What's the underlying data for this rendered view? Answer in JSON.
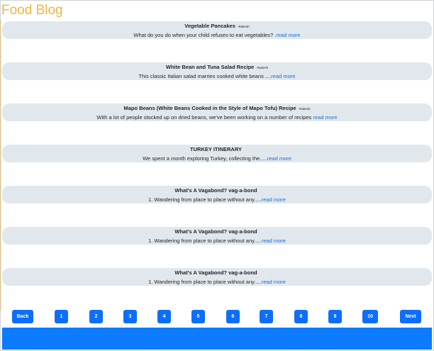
{
  "blog": {
    "title": "Food Blog"
  },
  "posts": [
    {
      "title": "Vegetable Pancakes",
      "author": "-Rakesh",
      "excerpt": "What do you do when your child refuses to eat vegetables? .",
      "read_more": "read more"
    },
    {
      "title": "White Bean and Tuna Salad Recipe",
      "author": "-Rakesh",
      "excerpt": "This classic Italian salad marries cooked white beans ....",
      "read_more": "read more"
    },
    {
      "title": "Mapo Beans (White Beans Cooked in the Style of Mapo Tofu) Recipe",
      "author": "-Rakesh",
      "excerpt": "With a lot of people stocked up on dried beans, we've been working on a number of recipes ",
      "read_more": "read more"
    },
    {
      "title": "TURKEY ITINERARY",
      "author": "",
      "excerpt": "We spent a month exploring Turkey, collecting the.....",
      "read_more": "read more"
    },
    {
      "title": "What's A Vagabond? vag-a-bond",
      "author": "",
      "excerpt": "1. Wandering from place to place without any.....",
      "read_more": "read more"
    },
    {
      "title": "What's A Vagabond? vag-a-bond",
      "author": "",
      "excerpt": "1. Wandering from place to place without any.....",
      "read_more": "read more"
    },
    {
      "title": "What's A Vagabond? vag-a-bond",
      "author": "",
      "excerpt": "1. Wandering from place to place without any.....",
      "read_more": "read more"
    }
  ],
  "pagination": {
    "back": "Back",
    "pages": [
      "1",
      "2",
      "3",
      "4",
      "5",
      "6",
      "7",
      "8",
      "9",
      "10"
    ],
    "next": "Next"
  },
  "colors": {
    "title": "#f0b73a",
    "card": "#e1e8ed",
    "link": "#1a6dd8",
    "button": "#0d6efd",
    "footer": "#0d7bff"
  }
}
